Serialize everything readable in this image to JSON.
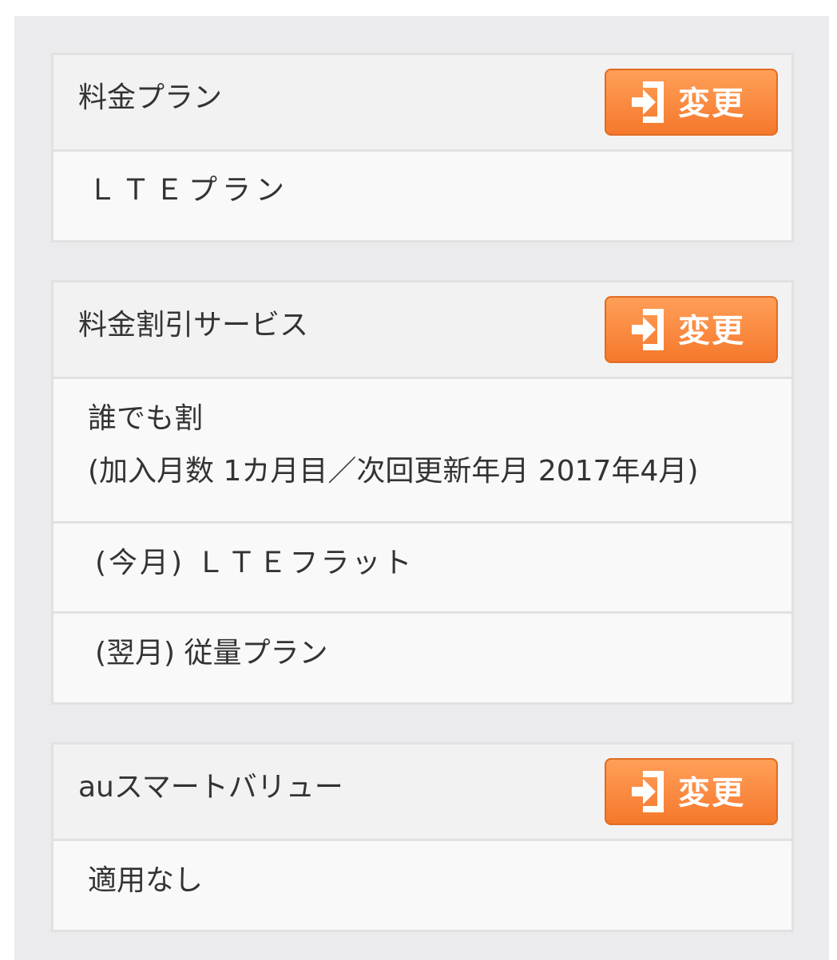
{
  "change_label": "変更",
  "sections": [
    {
      "title": "料金プラン",
      "rows": [
        "ＬＴＥプラン"
      ]
    },
    {
      "title": "料金割引サービス",
      "rows": [
        {
          "line1": "誰でも割",
          "line2": "(加入月数 1カ月目／次回更新年月 2017年4月)"
        },
        "(今月) ＬＴＥフラット",
        "(翌月) 従量プラン"
      ]
    },
    {
      "title": "auスマートバリュー",
      "rows": [
        "適用なし"
      ]
    }
  ],
  "colors": {
    "accent": "#f5782c",
    "background": "#ebebed",
    "header": "#f2f2f2",
    "border": "#e1e1e1"
  },
  "icons": [
    "sign-in-arrow-icon"
  ]
}
